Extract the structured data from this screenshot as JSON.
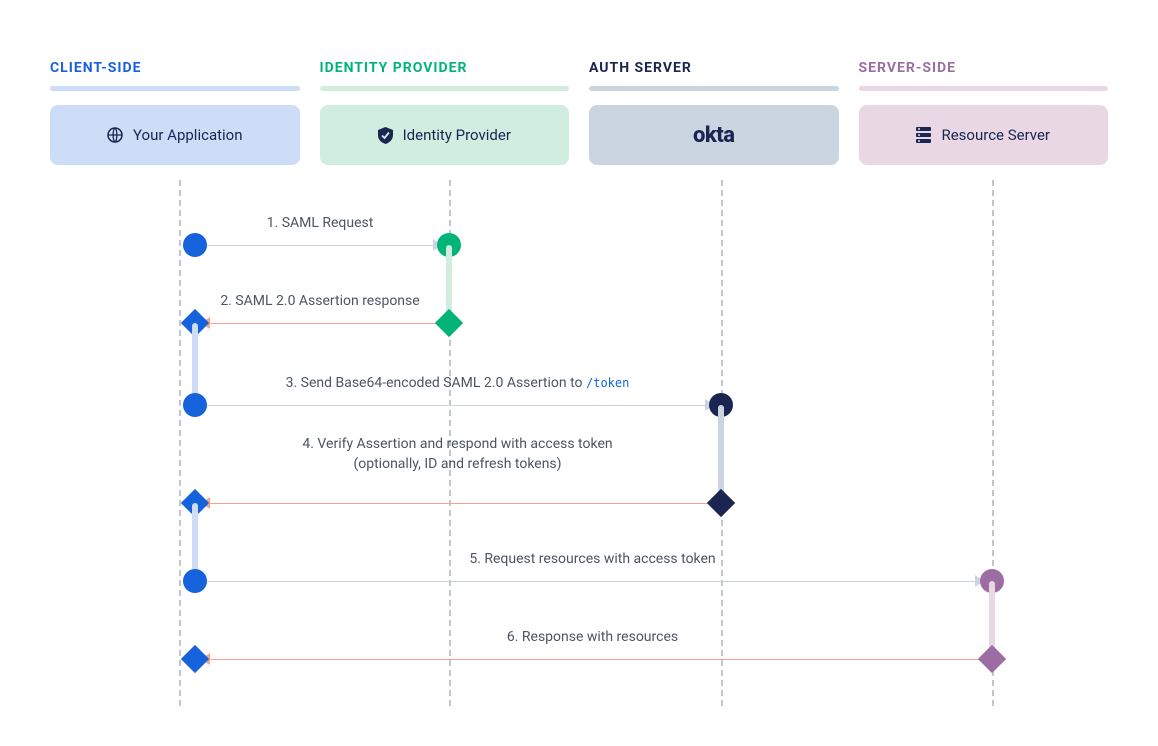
{
  "lanes": {
    "client": {
      "title": "CLIENT-SIDE",
      "card": "Your Application",
      "color": "#1662DD",
      "bg": "#CDDDF7"
    },
    "idp": {
      "title": "IDENTITY PROVIDER",
      "card": "Identity Provider",
      "color": "#00B478",
      "bg": "#D0EDE0"
    },
    "auth": {
      "title": "AUTH SERVER",
      "card": "okta",
      "color": "#1A2552",
      "bg": "#CBD5E1"
    },
    "server": {
      "title": "SERVER-SIDE",
      "card": "Resource Server",
      "color": "#9B6DA3",
      "bg": "#E9D8E3"
    }
  },
  "steps": {
    "s1": "1. SAML Request",
    "s2": "2. SAML 2.0 Assertion response",
    "s3a": "3. Send Base64-encoded SAML 2.0 Assertion to ",
    "s3b": "/token",
    "s4a": "4. Verify Assertion and respond with access token",
    "s4b": "(optionally, ID and refresh tokens)",
    "s5": "5. Request resources with access token",
    "s6": "6. Response with resources"
  }
}
